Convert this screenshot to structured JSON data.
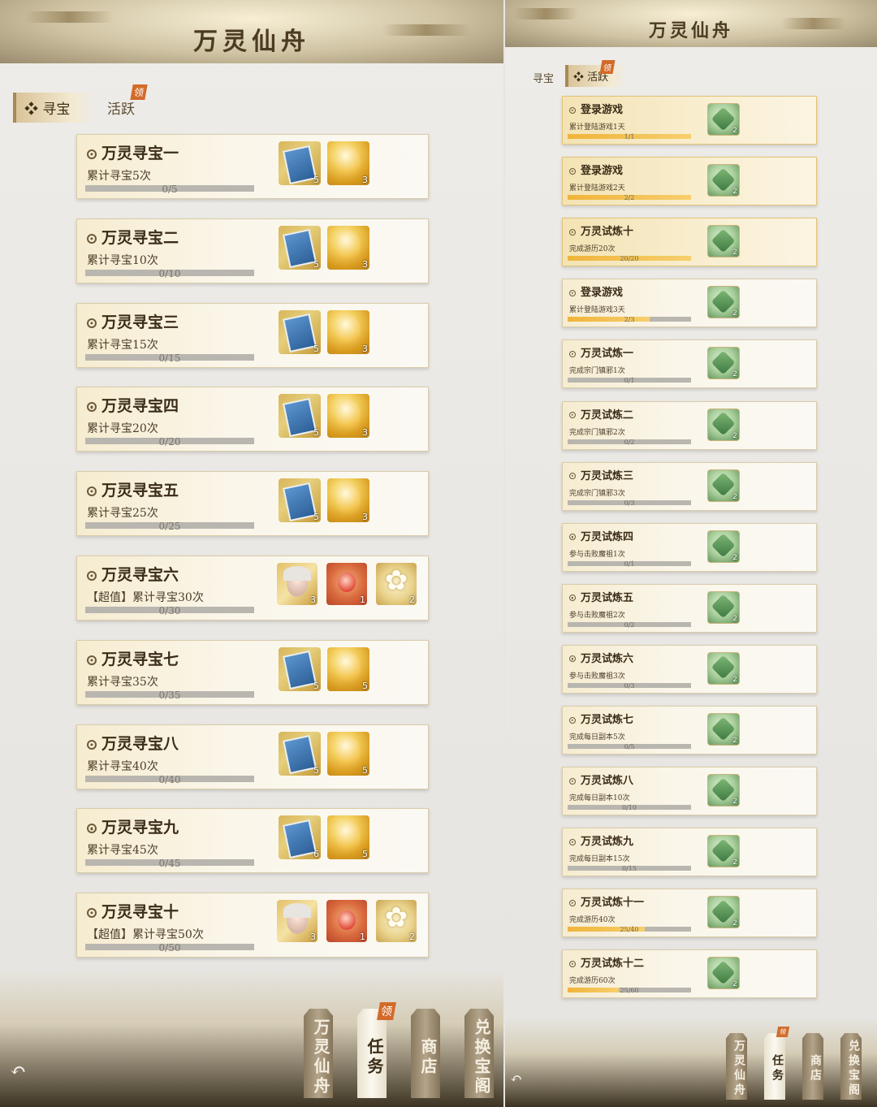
{
  "left": {
    "title": "万灵仙舟",
    "tabs": [
      {
        "label": "寻宝",
        "active": true,
        "badge": ""
      },
      {
        "label": "活跃",
        "active": false,
        "badge": "领"
      }
    ],
    "tasks": [
      {
        "title": "万灵寻宝一",
        "desc": "累计寻宝5次",
        "progress": "0/5",
        "rewards": [
          {
            "icon": "book-icon",
            "count": "5"
          },
          {
            "icon": "gold-ingot-icon",
            "count": "3"
          }
        ]
      },
      {
        "title": "万灵寻宝二",
        "desc": "累计寻宝10次",
        "progress": "0/10",
        "rewards": [
          {
            "icon": "book-icon",
            "count": "5"
          },
          {
            "icon": "gold-ingot-icon",
            "count": "3"
          }
        ]
      },
      {
        "title": "万灵寻宝三",
        "desc": "累计寻宝15次",
        "progress": "0/15",
        "rewards": [
          {
            "icon": "book-icon",
            "count": "5"
          },
          {
            "icon": "gold-ingot-icon",
            "count": "3"
          }
        ]
      },
      {
        "title": "万灵寻宝四",
        "desc": "累计寻宝20次",
        "progress": "0/20",
        "rewards": [
          {
            "icon": "book-icon",
            "count": "5"
          },
          {
            "icon": "gold-ingot-icon",
            "count": "3"
          }
        ]
      },
      {
        "title": "万灵寻宝五",
        "desc": "累计寻宝25次",
        "progress": "0/25",
        "rewards": [
          {
            "icon": "book-icon",
            "count": "5"
          },
          {
            "icon": "gold-ingot-icon",
            "count": "3"
          }
        ]
      },
      {
        "title": "万灵寻宝六",
        "desc": "【超值】累计寻宝30次",
        "progress": "0/30",
        "rewards": [
          {
            "icon": "sage-portrait-icon",
            "count": "3"
          },
          {
            "icon": "peach-icon",
            "count": "1"
          },
          {
            "icon": "lotus-icon",
            "count": "2"
          }
        ]
      },
      {
        "title": "万灵寻宝七",
        "desc": "累计寻宝35次",
        "progress": "0/35",
        "rewards": [
          {
            "icon": "book-icon",
            "count": "5"
          },
          {
            "icon": "gold-ingot-icon",
            "count": "5"
          }
        ]
      },
      {
        "title": "万灵寻宝八",
        "desc": "累计寻宝40次",
        "progress": "0/40",
        "rewards": [
          {
            "icon": "book-icon",
            "count": "5"
          },
          {
            "icon": "gold-ingot-icon",
            "count": "5"
          }
        ]
      },
      {
        "title": "万灵寻宝九",
        "desc": "累计寻宝45次",
        "progress": "0/45",
        "rewards": [
          {
            "icon": "book-icon",
            "count": "6"
          },
          {
            "icon": "gold-ingot-icon",
            "count": "5"
          }
        ]
      },
      {
        "title": "万灵寻宝十",
        "desc": "【超值】累计寻宝50次",
        "progress": "0/50",
        "rewards": [
          {
            "icon": "sage-portrait-icon",
            "count": "3"
          },
          {
            "icon": "peach-icon",
            "count": "1"
          },
          {
            "icon": "lotus-icon",
            "count": "2"
          }
        ]
      }
    ],
    "nav": [
      {
        "label": "万灵仙舟",
        "active": false,
        "badge": ""
      },
      {
        "label": "任务",
        "active": true,
        "badge": "领"
      },
      {
        "label": "商店",
        "active": false,
        "badge": ""
      },
      {
        "label": "兑换宝阁",
        "active": false,
        "badge": ""
      }
    ],
    "back_icon": "↶"
  },
  "right": {
    "title": "万灵仙舟",
    "tabs": [
      {
        "label": "寻宝",
        "active": false,
        "badge": ""
      },
      {
        "label": "活跃",
        "active": true,
        "badge": "领"
      }
    ],
    "tasks": [
      {
        "title": "登录游戏",
        "desc": "累计登陆游戏1天",
        "progress": "1/1",
        "fraction": 1,
        "done": true
      },
      {
        "title": "登录游戏",
        "desc": "累计登陆游戏2天",
        "progress": "2/2",
        "fraction": 1,
        "done": true
      },
      {
        "title": "万灵试炼十",
        "desc": "完成游历20次",
        "progress": "20/20",
        "fraction": 1,
        "done": true
      },
      {
        "title": "登录游戏",
        "desc": "累计登陆游戏3天",
        "progress": "2/3",
        "fraction": 0.6667,
        "done": false
      },
      {
        "title": "万灵试炼一",
        "desc": "完成宗门镇邪1次",
        "progress": "0/1",
        "fraction": 0,
        "done": false
      },
      {
        "title": "万灵试炼二",
        "desc": "完成宗门镇邪2次",
        "progress": "0/2",
        "fraction": 0,
        "done": false
      },
      {
        "title": "万灵试炼三",
        "desc": "完成宗门镇邪3次",
        "progress": "0/3",
        "fraction": 0,
        "done": false
      },
      {
        "title": "万灵试炼四",
        "desc": "参与击败魔祖1次",
        "progress": "0/1",
        "fraction": 0,
        "done": false
      },
      {
        "title": "万灵试炼五",
        "desc": "参与击败魔祖2次",
        "progress": "0/2",
        "fraction": 0,
        "done": false
      },
      {
        "title": "万灵试炼六",
        "desc": "参与击败魔祖3次",
        "progress": "0/3",
        "fraction": 0,
        "done": false
      },
      {
        "title": "万灵试炼七",
        "desc": "完成每日副本5次",
        "progress": "0/5",
        "fraction": 0,
        "done": false
      },
      {
        "title": "万灵试炼八",
        "desc": "完成每日副本10次",
        "progress": "0/10",
        "fraction": 0,
        "done": false
      },
      {
        "title": "万灵试炼九",
        "desc": "完成每日副本15次",
        "progress": "0/15",
        "fraction": 0,
        "done": false
      },
      {
        "title": "万灵试炼十一",
        "desc": "完成游历40次",
        "progress": "25/40",
        "fraction": 0.625,
        "done": false
      },
      {
        "title": "万灵试炼十二",
        "desc": "完成游历60次",
        "progress": "25/60",
        "fraction": 0.4167,
        "done": false
      }
    ],
    "reward": {
      "icon": "jade-token-icon",
      "count": "2"
    },
    "nav": [
      {
        "label": "万灵仙舟",
        "active": false,
        "badge": ""
      },
      {
        "label": "任务",
        "active": true,
        "badge": "领"
      },
      {
        "label": "商店",
        "active": false,
        "badge": ""
      },
      {
        "label": "兑换宝阁",
        "active": false,
        "badge": ""
      }
    ],
    "back_icon": "↶"
  }
}
